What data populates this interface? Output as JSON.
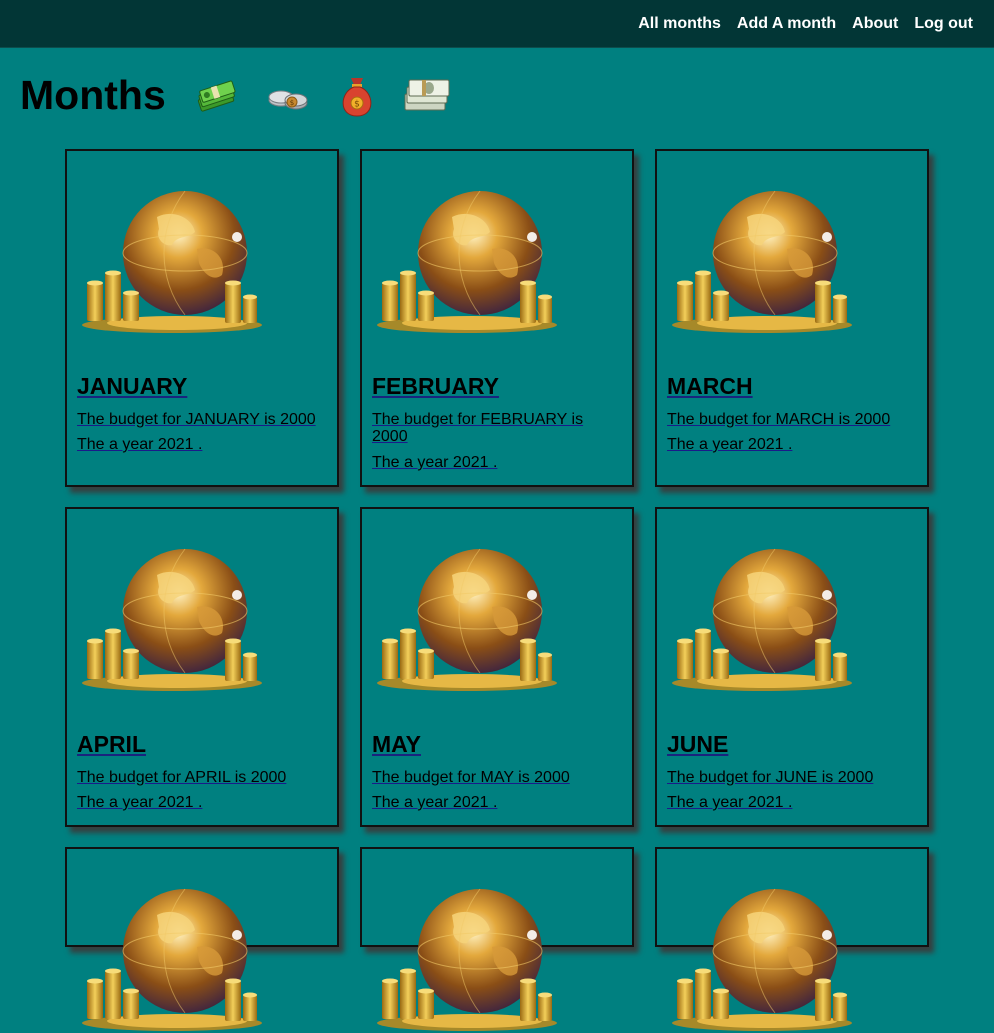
{
  "nav": {
    "links": [
      "All months",
      "Add A month",
      "About",
      "Log out"
    ]
  },
  "page": {
    "title": "Months"
  },
  "header_icons": [
    "cash-stack-icon",
    "coins-icon",
    "money-bag-icon",
    "banknotes-icon"
  ],
  "months": [
    {
      "name": "JANUARY",
      "budget_text": "The budget for JANUARY is 2000",
      "year_text": "The a year 2021 ."
    },
    {
      "name": "FEBRUARY",
      "budget_text": "The budget for FEBRUARY is 2000",
      "year_text": "The a year 2021 ."
    },
    {
      "name": "MARCH",
      "budget_text": "The budget for MARCH is 2000",
      "year_text": "The a year 2021 ."
    },
    {
      "name": "APRIL",
      "budget_text": "The budget for APRIL is 2000",
      "year_text": "The a year 2021 ."
    },
    {
      "name": "MAY",
      "budget_text": "The budget for MAY is 2000",
      "year_text": "The a year 2021 ."
    },
    {
      "name": "JUNE",
      "budget_text": "The budget for JUNE is 2000",
      "year_text": "The a year 2021 ."
    }
  ],
  "colors": {
    "background": "#008080",
    "navbar": "#023636",
    "card_border": "#111111",
    "card_shadow": "#5a1414"
  }
}
